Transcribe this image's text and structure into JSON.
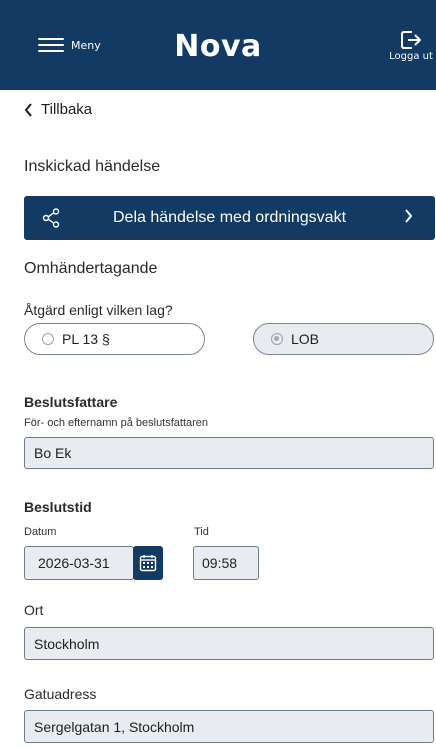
{
  "header": {
    "menu_label": "Meny",
    "brand": "Nova",
    "logout_label": "Logga ut"
  },
  "nav": {
    "back_label": "Tillbaka"
  },
  "sections": {
    "submitted": "Inskickad händelse",
    "share_button": "Dela händelse med ordningsvakt",
    "custody": "Omhändertagande"
  },
  "law": {
    "question": "Åtgärd enligt vilken lag?",
    "options": [
      "PL 13 §",
      "LOB"
    ],
    "selected": "LOB"
  },
  "decision_maker": {
    "label": "Beslutsfattare",
    "helper": "För- och efternamn på beslutsfattaren",
    "value": "Bo Ek"
  },
  "decision_time": {
    "label": "Beslutstid",
    "date_label": "Datum",
    "date_value": "2026-03-31",
    "time_label": "Tid",
    "time_value": "09:58"
  },
  "location": {
    "city_label": "Ort",
    "city_value": "Stockholm",
    "street_label": "Gatuadress",
    "street_value": "Sergelgatan 1, Stockholm"
  },
  "colors": {
    "primary": "#123a63",
    "field_bg": "#e8ebef"
  }
}
